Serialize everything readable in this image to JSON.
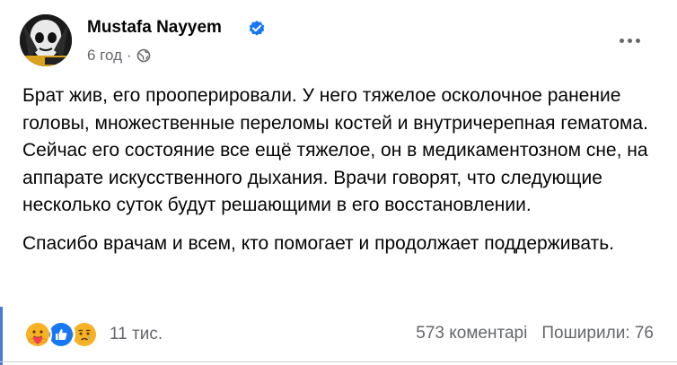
{
  "post": {
    "author": "Mustafa Nayyem",
    "time": "6 год",
    "separator": "·",
    "visibility_icon": "globe-icon",
    "verified_icon": "verified-badge-icon",
    "more_icon": "more-horizontal-icon",
    "paragraphs": [
      "Брат жив, его прооперировали. У него тяжелое осколочное ранение головы, множественные переломы костей и внутричерепная гематома. Сейчас его состояние все ещё тяжелое, он в медикаментозном сне, на аппарате искусственного дыхания. Врачи говорят, что следующие несколько суток будут решающими в его восстановлении.",
      "Спасибо врачам и всем, кто помогает и продолжает поддерживать."
    ]
  },
  "footer": {
    "reactions": [
      "care-reaction-icon",
      "like-reaction-icon",
      "sad-reaction-icon"
    ],
    "reaction_count": "11 тис.",
    "comments": "573 коментарі",
    "shares": "Поширили: 76"
  },
  "colors": {
    "accent": "#1877f2",
    "secondary_text": "#65676b"
  }
}
